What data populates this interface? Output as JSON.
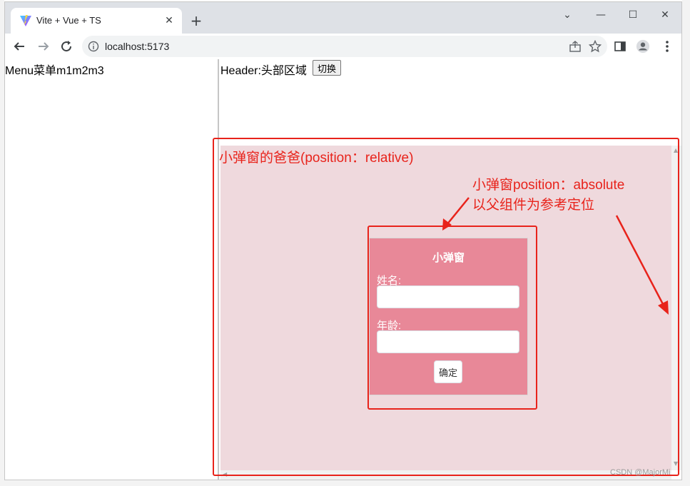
{
  "browser": {
    "tab_title": "Vite + Vue + TS",
    "url": "localhost:5173",
    "icons": [
      "vite-favicon",
      "close-icon",
      "plus-icon",
      "minimize-icon",
      "maximize-icon",
      "window-close-icon",
      "back-icon",
      "forward-icon",
      "reload-icon",
      "info-icon",
      "share-icon",
      "star-icon",
      "side-panel-icon",
      "profile-icon",
      "more-icon"
    ]
  },
  "page": {
    "menu_text": "Menu菜单m1m2m3",
    "header_text": "Header:头部区域",
    "switch_label": "切换",
    "content_bg": "#efd9dd"
  },
  "modal": {
    "title": "小弹窗",
    "name_label": "姓名:",
    "name_value": "",
    "age_label": "年龄:",
    "age_value": "",
    "confirm_label": "确定",
    "bg_color": "#e88898"
  },
  "annotations": {
    "parent_label": "小弹窗的爸爸(position：relative)",
    "modal_note_line1": "小弹窗position：absolute",
    "modal_note_line2": "以父组件为参考定位",
    "color": "#e8231b"
  },
  "watermark": "CSDN @MajorMi"
}
